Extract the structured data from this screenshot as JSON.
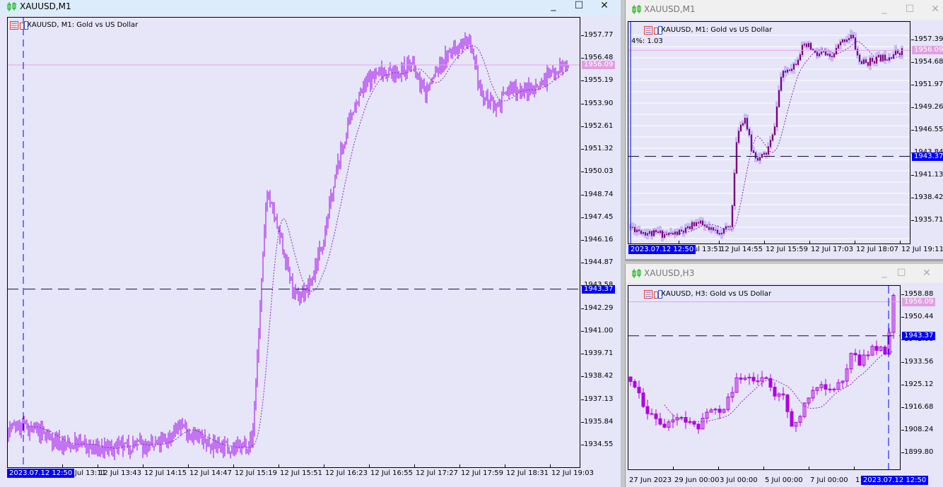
{
  "colors": {
    "plot_bg": "#e6e6f8",
    "bar_m1": "#a000f0",
    "candle_m1_small": "#800080",
    "candle_h3": "#b000e0",
    "ma_line": "#9020c0",
    "current_price_bg": "#e0a0e0",
    "line_price_bg": "#0000ff",
    "cursor_line": "#0000ff"
  },
  "windows": [
    {
      "title": "XAUUSD,M1",
      "chart_header": "XAUUSD, M1:  Gold vs US Dollar",
      "icons": [
        "candlestick-app-icon",
        "chart-list-icon",
        "chart-template-icon"
      ],
      "buttons": {
        "minimize": "_",
        "maximize": "☐",
        "close": "✕"
      },
      "price_labels": [
        "1957.77",
        "1956.48",
        "1955.19",
        "1953.90",
        "1952.61",
        "1951.32",
        "1950.03",
        "1948.74",
        "1947.45",
        "1946.16",
        "1944.87",
        "1943.58",
        "1942.29",
        "1941.00",
        "1939.71",
        "1938.42",
        "1937.13",
        "1935.84",
        "1934.55"
      ],
      "time_labels": [
        "12 Jul 13:11",
        "12 Jul 13:43",
        "12 Jul 14:15",
        "12 Jul 14:47",
        "12 Jul 15:19",
        "12 Jul 15:51",
        "12 Jul 16:23",
        "12 Jul 16:55",
        "12 Jul 17:27",
        "12 Jul 17:59",
        "12 Jul 18:31",
        "12 Jul 19:03"
      ],
      "current_price": "1956.09",
      "line_price": "1943.37",
      "cursor_time": "2023.07.12 12:50",
      "approx_close": [
        1935.5,
        1935.6,
        1935.3,
        1934.9,
        1934.5,
        1934.6,
        1934.3,
        1934.3,
        1934.4,
        1934.6,
        1934.4,
        1934.8,
        1935.7,
        1935.0,
        1934.6,
        1934.5,
        1934.3,
        1934.8,
        1949.0,
        1946.0,
        1942.8,
        1943.5,
        1946.5,
        1950.6,
        1953.6,
        1955.2,
        1955.8,
        1955.5,
        1956.2,
        1954.5,
        1956.0,
        1957.0,
        1957.5,
        1954.3,
        1953.8,
        1954.8,
        1954.6,
        1955.0,
        1955.8,
        1956.1
      ]
    },
    {
      "title": "XAUUSD,M1",
      "chart_header": "XAUUSD, M1:  Gold vs US Dollar",
      "indicator_text": "4%: 1.03",
      "icons": [
        "candlestick-app-icon",
        "chart-list-icon",
        "chart-template-icon"
      ],
      "buttons": {
        "minimize": "_",
        "maximize": "☐",
        "close": "✕"
      },
      "price_labels": [
        "1957.39",
        "1954.68",
        "1951.97",
        "1949.26",
        "1946.55",
        "1943.84",
        "1941.13",
        "1938.42",
        "1935.71"
      ],
      "time_labels": [
        "12 Jul 13:51",
        "12 Jul 14:55",
        "12 Jul 15:59",
        "12 Jul 17:03",
        "12 Jul 18:07",
        "12 Jul 19:11"
      ],
      "current_price": "1956.09",
      "line_price": "1943.37",
      "cursor_time": "2023.07.12 12:50",
      "approx_close": [
        1934.9,
        1934.6,
        1934.3,
        1934.1,
        1934.2,
        1934.0,
        1934.1,
        1934.3,
        1934.6,
        1935.5,
        1935.2,
        1934.5,
        1934.4,
        1934.5,
        1935.0,
        1946.5,
        1948.2,
        1944.0,
        1943.1,
        1943.8,
        1946.0,
        1952.8,
        1953.9,
        1954.5,
        1956.4,
        1956.6,
        1955.5,
        1955.8,
        1955.0,
        1956.5,
        1957.5,
        1957.9,
        1954.8,
        1954.6,
        1955.0,
        1955.2,
        1955.4,
        1955.8,
        1956.1
      ]
    },
    {
      "title": "XAUUSD,H3",
      "chart_header": "XAUUSD, H3:  Gold vs US Dollar",
      "icons": [
        "candlestick-app-icon",
        "chart-list-icon",
        "chart-template-icon"
      ],
      "buttons": {
        "minimize": "_",
        "maximize": "☐",
        "close": "✕"
      },
      "price_labels": [
        "1958.88",
        "1950.44",
        "1942.00",
        "1933.56",
        "1925.12",
        "1916.68",
        "1908.24",
        "1899.80"
      ],
      "time_labels": [
        "27 Jun 2023",
        "29 Jun 00:00",
        "3 Jul 00:00",
        "5 Jul 00:00",
        "7 Jul 00:00",
        "11"
      ],
      "current_price": "1956.09",
      "line_price": "1943.37",
      "cursor_time": "2023.07.12 12:50",
      "approx_close": [
        1928.0,
        1922.0,
        1916.0,
        1912.6,
        1910.5,
        1910.1,
        1912.0,
        1910.0,
        1907.3,
        1914.5,
        1918.0,
        1915.0,
        1924.0,
        1928.5,
        1929.0,
        1928.0,
        1926.0,
        1920.0,
        1922.5,
        1911.0,
        1913.0,
        1920.0,
        1926.0,
        1925.0,
        1924.0,
        1928.0,
        1935.7,
        1934.0,
        1936.0,
        1939.6,
        1935.0,
        1956.8
      ]
    }
  ]
}
